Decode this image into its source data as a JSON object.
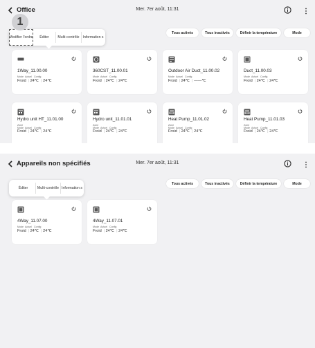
{
  "screen1": {
    "title": "Office",
    "datetime": "Mer. 7er août, 11:31",
    "step_number": "1",
    "popup": {
      "item1": "Modifier l'ordre",
      "item2": "Éditer",
      "item3": "Multi-contrôle",
      "item4": "Information s"
    },
    "buttons": {
      "all_on": "Tous activés",
      "all_off": "Tous inactivés",
      "set_temp": "Définir la température",
      "mode": "Mode"
    },
    "labels": {
      "mode": "Mode",
      "actuel": "Actuel",
      "config": "Config",
      "zone": "Zone"
    },
    "devices": [
      {
        "name": "1Way_11.00.00",
        "icon": "1way-cassette-icon",
        "mode": "Froid",
        "actuel": "24℃",
        "config": "24℃"
      },
      {
        "name": "360CST_11.00.01",
        "icon": "360-cassette-icon",
        "mode": "Froid",
        "actuel": "24℃",
        "config": "24℃"
      },
      {
        "name": "Outdoor Air Duct_11.00.02",
        "icon": "outdoor-air-duct-icon",
        "mode": "Froid",
        "actuel": "24℃",
        "config": "——℃"
      },
      {
        "name": "Duct_11.00.03",
        "icon": "duct-icon",
        "mode": "Froid",
        "actuel": "24℃",
        "config": "24℃"
      },
      {
        "name": "Hydro unit HT_11.01.00",
        "icon": "hydro-unit-icon",
        "mode": "Froid",
        "actuel": "24℃",
        "config": "24℃"
      },
      {
        "name": "Hydro unit_11.01.01",
        "icon": "hydro-unit-icon",
        "mode": "Froid",
        "actuel": "24℃",
        "config": "24℃"
      },
      {
        "name": "Heat Pump_11.01.02",
        "icon": "heat-pump-icon",
        "mode": "Froid",
        "actuel": "24℃",
        "config": "24℃"
      },
      {
        "name": "Heat Pump_11.01.03",
        "icon": "heat-pump-icon",
        "mode": "Froid",
        "actuel": "24℃",
        "config": "24℃"
      }
    ]
  },
  "screen2": {
    "title": "Appareils non spécifiés",
    "datetime": "Mer. 7er août, 11:31",
    "popup": {
      "item1": "Éditer",
      "item2": "Multi-contrôle",
      "item3": "Information s"
    },
    "buttons": {
      "all_on": "Tous activés",
      "all_off": "Tous inactivés",
      "set_temp": "Définir la température",
      "mode": "Mode"
    },
    "labels": {
      "mode": "Mode",
      "actuel": "Actuel",
      "config": "Config"
    },
    "devices": [
      {
        "name": "4Way_11.07.00",
        "icon": "4way-cassette-icon",
        "mode": "Froid",
        "actuel": "24℃",
        "config": "24℃"
      },
      {
        "name": "4Way_11.07.01",
        "icon": "4way-cassette-icon",
        "mode": "Froid",
        "actuel": "24℃",
        "config": "24℃"
      }
    ]
  }
}
